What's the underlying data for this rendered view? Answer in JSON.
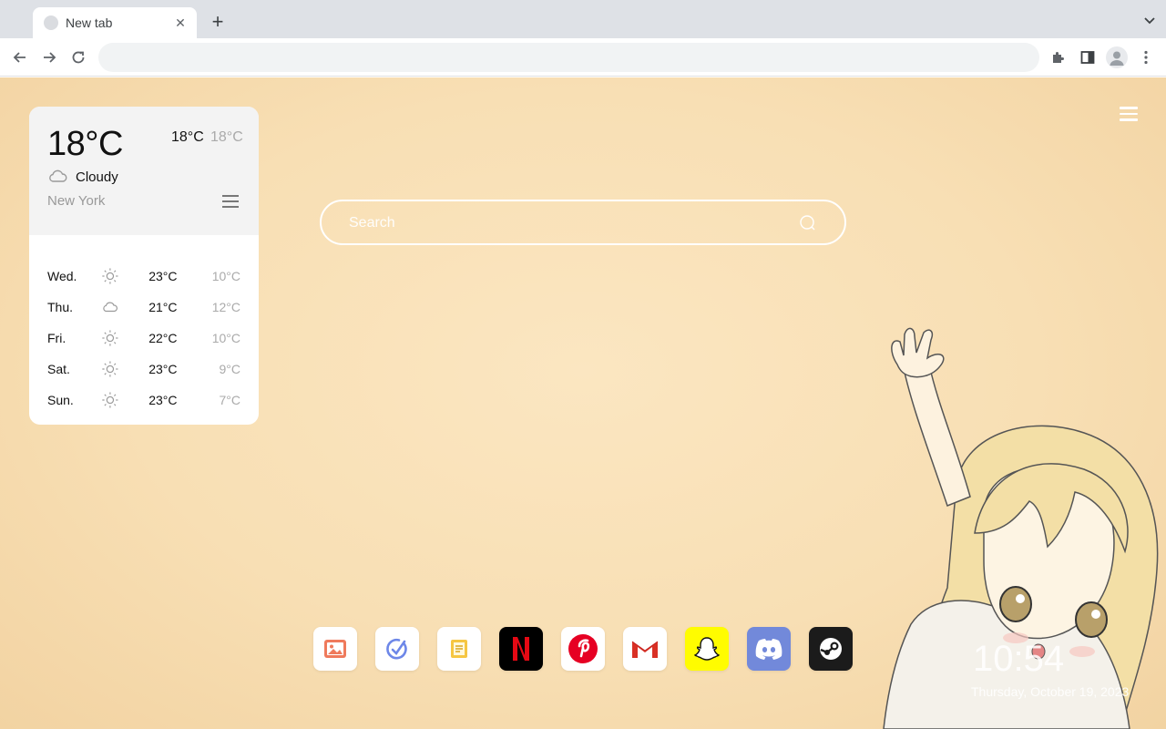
{
  "browser": {
    "tab_title": "New tab",
    "omnibox_value": "",
    "omnibox_placeholder": ""
  },
  "weather": {
    "current_temp": "18°C",
    "high": "18°C",
    "low": "18°C",
    "condition": "Cloudy",
    "condition_icon": "cloud-icon",
    "city": "New York",
    "forecast": [
      {
        "day": "Wed.",
        "icon": "sun-icon",
        "high": "23°C",
        "low": "10°C"
      },
      {
        "day": "Thu.",
        "icon": "cloud-icon",
        "high": "21°C",
        "low": "12°C"
      },
      {
        "day": "Fri.",
        "icon": "sun-icon",
        "high": "22°C",
        "low": "10°C"
      },
      {
        "day": "Sat.",
        "icon": "sun-icon",
        "high": "23°C",
        "low": "9°C"
      },
      {
        "day": "Sun.",
        "icon": "sun-icon",
        "high": "23°C",
        "low": "7°C"
      }
    ]
  },
  "search": {
    "placeholder": "Search",
    "value": ""
  },
  "dock": {
    "apps": [
      {
        "name": "gallery",
        "icon": "image-icon",
        "bg": "#ffffff"
      },
      {
        "name": "tasks",
        "icon": "check-icon",
        "bg": "#ffffff"
      },
      {
        "name": "notes",
        "icon": "notes-icon",
        "bg": "#ffffff"
      },
      {
        "name": "netflix",
        "icon": "netflix-icon",
        "bg": "#000000"
      },
      {
        "name": "pinterest",
        "icon": "pinterest-icon",
        "bg": "#ffffff"
      },
      {
        "name": "gmail",
        "icon": "gmail-icon",
        "bg": "#ffffff"
      },
      {
        "name": "snapchat",
        "icon": "snapchat-icon",
        "bg": "#fffc00"
      },
      {
        "name": "discord",
        "icon": "discord-icon",
        "bg": "#7289da"
      },
      {
        "name": "steam",
        "icon": "steam-icon",
        "bg": "#1b1b1b"
      }
    ]
  },
  "clock": {
    "time": "10:54",
    "date": "Thursday, October 19, 2023"
  },
  "colors": {
    "page_bg": "#f8dfb4",
    "card_top": "#f3f3f3",
    "accent_white": "#ffffff"
  }
}
